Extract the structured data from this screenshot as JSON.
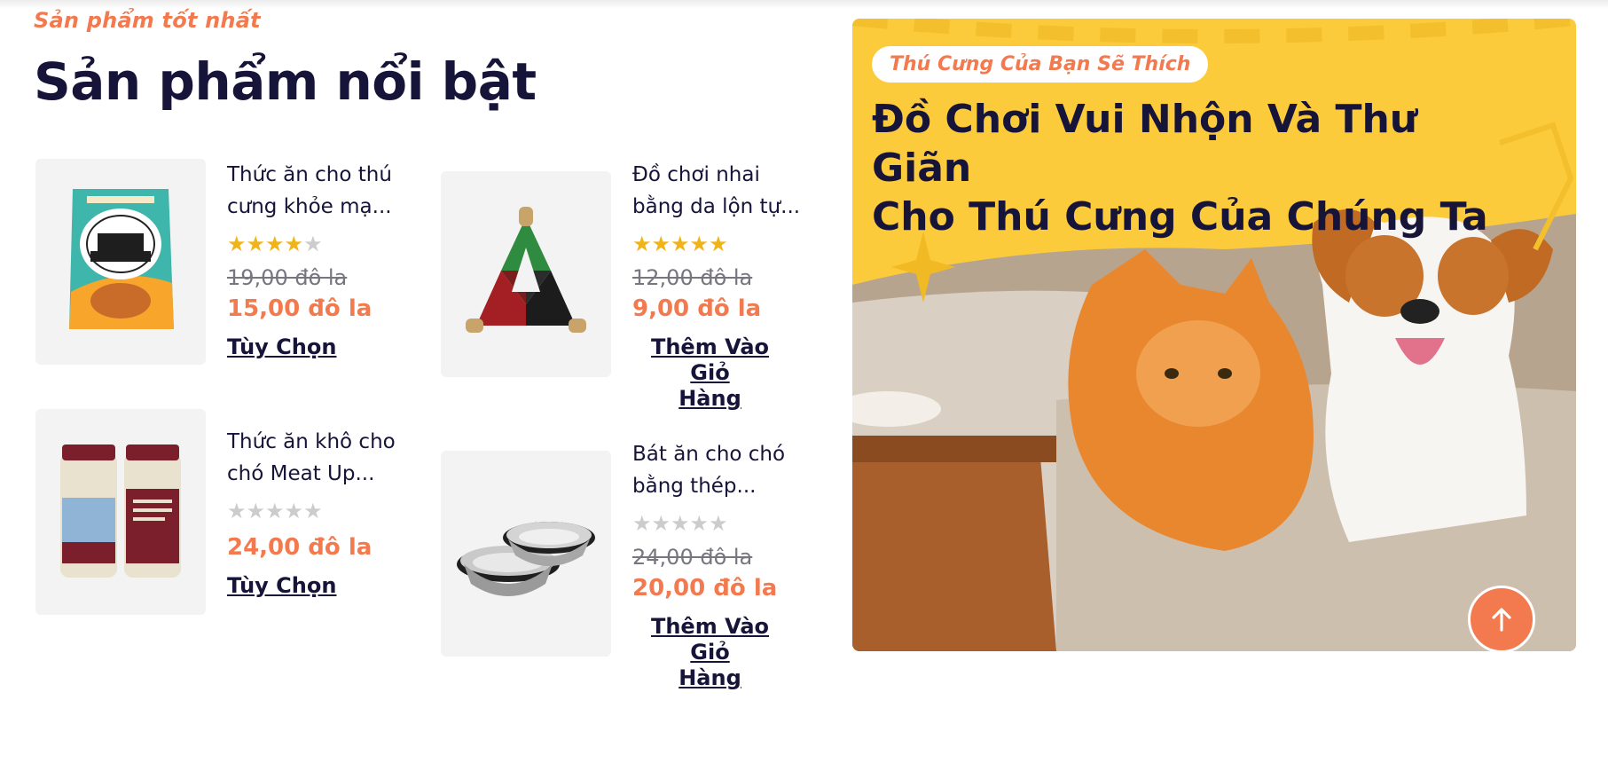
{
  "section": {
    "eyebrow": "Sản phẩm tốt nhất",
    "title": "Sản phẩm nổi bật"
  },
  "products": [
    {
      "name_line1": "Thức ăn cho thú",
      "name_line2": "cưng khỏe mạ...",
      "rating": 4,
      "old_price": "19,00 đô la",
      "price": "15,00 đô la",
      "action": "Tùy Chọn",
      "image_icon": "pet-food-pouch-icon"
    },
    {
      "name_line1": "Đồ chơi nhai",
      "name_line2": "bằng da lộn tự...",
      "rating": 5,
      "old_price": "12,00 đô la",
      "price": "9,00 đô la",
      "action_line1": "Thêm Vào Giỏ",
      "action_line2": "Hàng",
      "image_icon": "chew-toy-icon"
    },
    {
      "name_line1": "Thức ăn khô cho",
      "name_line2": "chó Meat Up...",
      "rating": 0,
      "price": "24,00 đô la",
      "action": "Tùy Chọn",
      "image_icon": "dog-treat-jars-icon"
    },
    {
      "name_line1": "Bát ăn cho chó",
      "name_line2": "bằng thép...",
      "rating": 0,
      "old_price": "24,00 đô la",
      "price": "20,00 đô la",
      "action_line1": "Thêm Vào Giỏ",
      "action_line2": "Hàng",
      "image_icon": "steel-bowls-icon"
    }
  ],
  "banner": {
    "badge": "Thú Cưng Của Bạn Sẽ Thích",
    "title_line1": "Đồ Chơi Vui Nhộn Và Thư Giãn",
    "title_line2": "Cho Thú Cưng Của Chúng Ta",
    "image_icon": "cat-and-dog-on-sofa-icon"
  },
  "scroll_top": {
    "icon": "arrow-up-icon"
  },
  "colors": {
    "accent": "#f27a4e",
    "dark": "#161438",
    "star": "#f0b418",
    "banner_bg": "#fbcb3b"
  }
}
